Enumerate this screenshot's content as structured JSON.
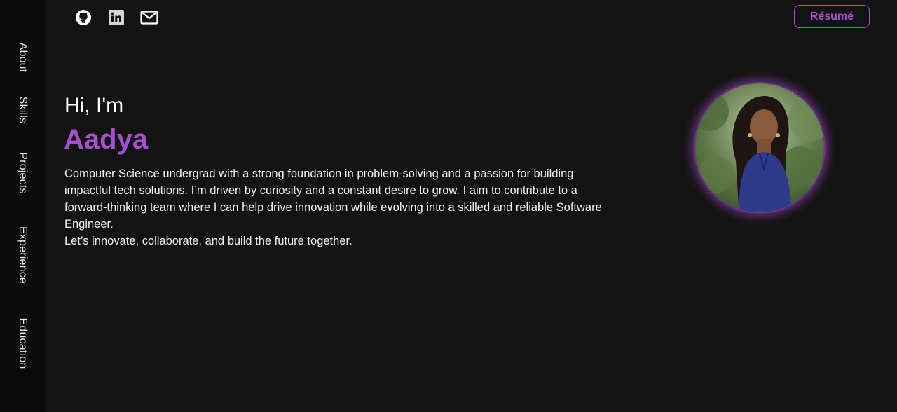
{
  "sidebar": {
    "items": [
      {
        "label": "About"
      },
      {
        "label": "Skills"
      },
      {
        "label": "Projects"
      },
      {
        "label": "Experience"
      },
      {
        "label": "Education"
      }
    ]
  },
  "header": {
    "social_icons": [
      "github-icon",
      "linkedin-icon",
      "mail-icon"
    ],
    "resume_label": "Résumé"
  },
  "hero": {
    "greeting": "Hi, I'm",
    "name": "Aadya",
    "bio_paragraph": "Computer Science undergrad with a strong foundation in problem-solving and a passion for building impactful tech solutions. I’m driven by curiosity and a constant desire to grow. I aim to contribute to a forward-thinking team where I can help drive innovation while evolving into a skilled and reliable Software Engineer.",
    "bio_closing": "Let’s innovate, collaborate, and build the future together."
  },
  "colors": {
    "accent": "#a64fd0",
    "background": "#141313",
    "sidebar": "#0b0b0b",
    "text": "#ffffff"
  }
}
